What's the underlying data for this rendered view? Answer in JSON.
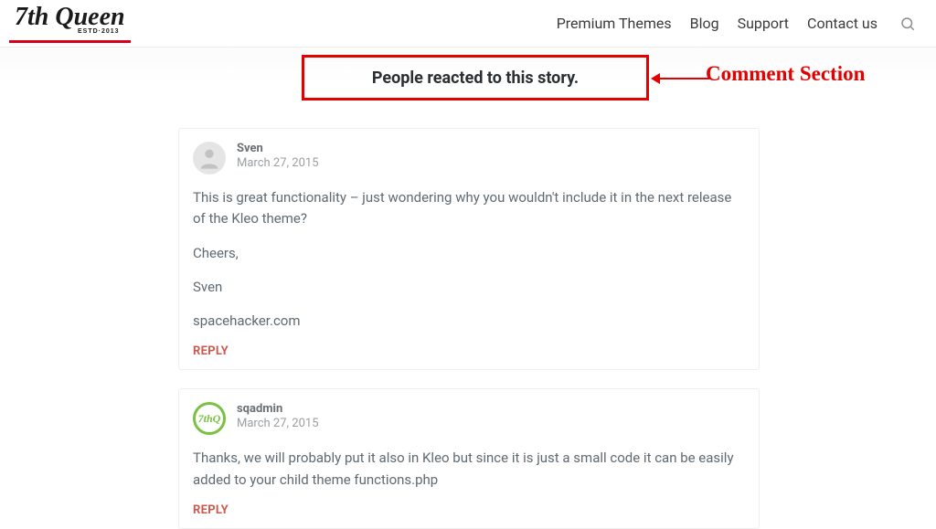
{
  "logo": {
    "text": "7th Queen",
    "estd": "ESTD·2013"
  },
  "nav": {
    "items": [
      {
        "label": "Premium Themes"
      },
      {
        "label": "Blog"
      },
      {
        "label": "Support"
      },
      {
        "label": "Contact us"
      }
    ]
  },
  "section_title": "People reacted to this story.",
  "annotation": "Comment Section",
  "reply_label": "REPLY",
  "comments": [
    {
      "author": "Sven",
      "date": "March 27, 2015",
      "avatar_type": "default",
      "paragraphs": [
        "This is great functionality – just wondering why you wouldn't include it in the next release of the Kleo theme?",
        "Cheers,",
        "Sven",
        "spacehacker.com"
      ]
    },
    {
      "author": "sqadmin",
      "date": "March 27, 2015",
      "avatar_type": "admin",
      "paragraphs": [
        "Thanks, we will probably put it also in Kleo but since it is just a small code it can be easily added to your child theme functions.php"
      ]
    }
  ]
}
